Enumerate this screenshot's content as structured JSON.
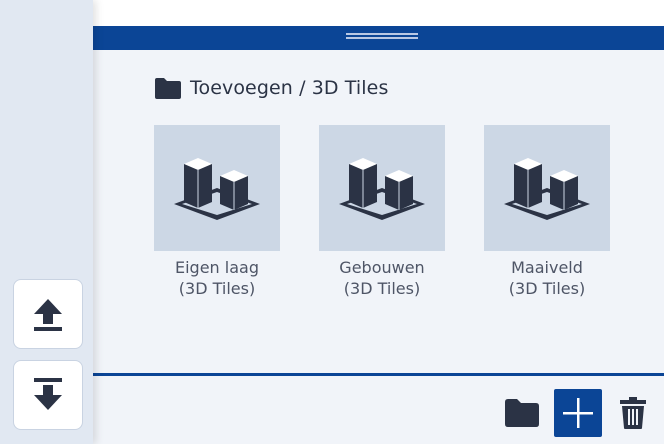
{
  "breadcrumb": {
    "icon": "folder-icon",
    "text": "Toevoegen / 3D Tiles"
  },
  "tiles": [
    {
      "icon": "buildings-3d-icon",
      "label_line1": "Eigen laag",
      "label_line2": "(3D Tiles)"
    },
    {
      "icon": "buildings-3d-icon",
      "label_line1": "Gebouwen",
      "label_line2": "(3D Tiles)"
    },
    {
      "icon": "buildings-3d-icon",
      "label_line1": "Maaiveld",
      "label_line2": "(3D Tiles)"
    }
  ],
  "left_rail": {
    "buttons": [
      {
        "icon": "move-to-top-icon"
      },
      {
        "icon": "move-to-bottom-icon"
      }
    ]
  },
  "footer": {
    "buttons": [
      {
        "icon": "folder-icon"
      },
      {
        "icon": "plus-icon"
      },
      {
        "icon": "trash-icon"
      }
    ]
  },
  "colors": {
    "accent": "#0b4596",
    "panel_bg": "#f1f4f9",
    "tile_bg": "#ccd7e5",
    "rail_bg": "#e1e8f2",
    "icon_dark": "#2b3345"
  }
}
